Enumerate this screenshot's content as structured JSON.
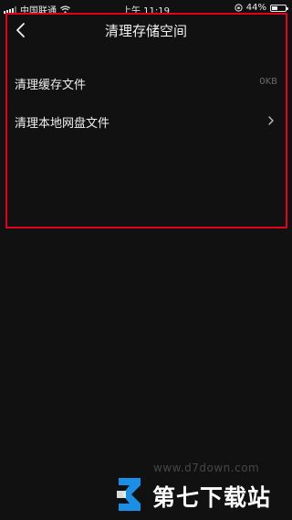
{
  "status_bar": {
    "carrier": "中国联通",
    "time": "上午 11:19",
    "battery": "44%",
    "battery_level": 0.44
  },
  "header": {
    "title": "清理存储空间"
  },
  "items": [
    {
      "label": "清理缓存文件",
      "value": "0KB"
    },
    {
      "label": "清理本地网盘文件"
    }
  ],
  "watermark": {
    "url": "www.d7down.com",
    "brand": "第七下载站"
  },
  "colors": {
    "highlight": "#e3001b",
    "background": "#111111",
    "logo_blue": "#1a8fe6"
  }
}
